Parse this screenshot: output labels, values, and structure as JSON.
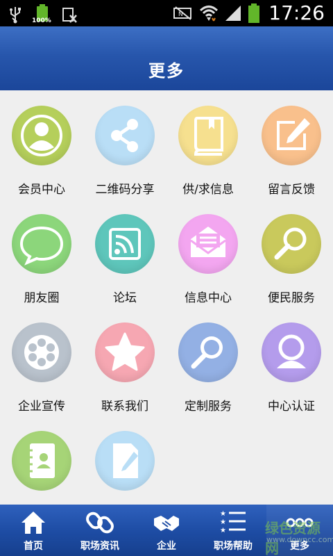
{
  "status_bar": {
    "time": "17:26",
    "battery_percent_label": "100%",
    "icons": [
      "usb-icon",
      "battery-icon",
      "keyboard-icon",
      "nfc-icon",
      "wifi-icon",
      "signal-icon",
      "battery-full-icon"
    ]
  },
  "header": {
    "title": "更多"
  },
  "grid": {
    "items": [
      {
        "label": "会员中心",
        "icon": "member-icon",
        "color": "#b5cf5b"
      },
      {
        "label": "二维码分享",
        "icon": "share-icon",
        "color": "#b9def6"
      },
      {
        "label": "供/求信息",
        "icon": "book-icon",
        "color": "#f6e08f"
      },
      {
        "label": "留言反馈",
        "icon": "edit-icon",
        "color": "#f9c08c"
      },
      {
        "label": "朋友圈",
        "icon": "chat-bubble-icon",
        "color": "#8cd67b"
      },
      {
        "label": "论坛",
        "icon": "rss-icon",
        "color": "#5ec6bb"
      },
      {
        "label": "信息中心",
        "icon": "mail-icon",
        "color": "#f3a6f0"
      },
      {
        "label": "便民服务",
        "icon": "search-icon",
        "color": "#c9c95c"
      },
      {
        "label": "企业宣传",
        "icon": "film-reel-icon",
        "color": "#b9c2cc"
      },
      {
        "label": "联系我们",
        "icon": "star-icon",
        "color": "#f6a7b2"
      },
      {
        "label": "定制服务",
        "icon": "magnifier-icon",
        "color": "#93b0e4"
      },
      {
        "label": "中心认证",
        "icon": "user-icon",
        "color": "#b49cec"
      },
      {
        "label": "",
        "icon": "contacts-book-icon",
        "color": "#a6d477"
      },
      {
        "label": "",
        "icon": "document-edit-icon",
        "color": "#b9def6"
      }
    ]
  },
  "tabbar": {
    "tabs": [
      {
        "label": "首页",
        "icon": "home-icon"
      },
      {
        "label": "职场资讯",
        "icon": "link-icon"
      },
      {
        "label": "企业",
        "icon": "handshake-icon"
      },
      {
        "label": "职场帮助",
        "icon": "list-icon"
      },
      {
        "label": "更多",
        "icon": "more-dots-icon"
      }
    ]
  },
  "watermark": {
    "line1": "绿色资源网",
    "line2": "www.downcc.com"
  }
}
